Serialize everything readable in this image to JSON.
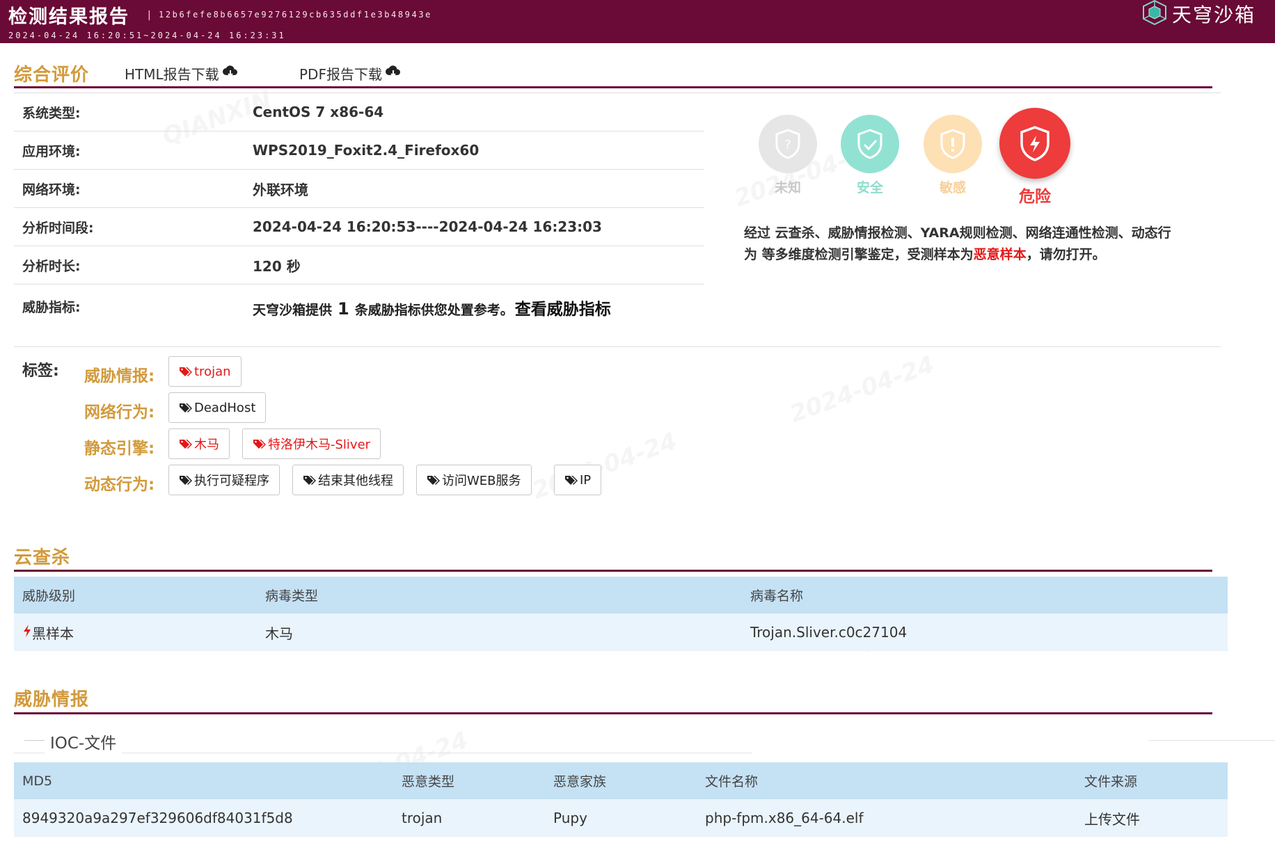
{
  "header": {
    "title": "检测结果报告",
    "separator": "|",
    "hash": "12b6fefe8b6657e9276129cb635ddf1e3b48943e",
    "period": "2024-04-24 16:20:51~2024-04-24 16:23:31",
    "brand": "天穹沙箱",
    "bg_color": "#6a0a36"
  },
  "summary": {
    "title": "综合评价",
    "html_download": "HTML报告下载",
    "pdf_download": "PDF报告下载",
    "rows": [
      {
        "label": "系统类型:",
        "value": "CentOS 7 x86-64"
      },
      {
        "label": "应用环境:",
        "value": "WPS2019_Foxit2.4_Firefox60"
      },
      {
        "label": "网络环境:",
        "value": "外联环境"
      },
      {
        "label": "分析时间段:",
        "value": "2024-04-24 16:20:53----2024-04-24 16:23:03"
      },
      {
        "label": "分析时长:",
        "value": "120 秒"
      }
    ],
    "ioc": {
      "label": "威胁指标:",
      "prefix": "天穹沙箱提供",
      "count": "1",
      "suffix": "条威胁指标供您处置参考。",
      "link": "查看威胁指标"
    }
  },
  "risk": {
    "levels": [
      {
        "label": "未知",
        "icon": "question-shield-icon",
        "color": "#d4d4d4",
        "active": false
      },
      {
        "label": "安全",
        "icon": "check-shield-icon",
        "color": "#6fd7c4",
        "active": false
      },
      {
        "label": "敏感",
        "icon": "exclamation-shield-icon",
        "color": "#fbd49a",
        "active": false
      },
      {
        "label": "危险",
        "icon": "lightning-shield-icon",
        "color": "#ee3b3b",
        "active": true
      }
    ],
    "verdict": {
      "line1": "经过 云查杀、威胁情报检测、YARA规则检测、网络连通性检测、动态行",
      "line2_prefix": "为 等多维度检测引擎鉴定，受测样本为",
      "highlight": "恶意样本",
      "line2_suffix": "，请勿打开。"
    }
  },
  "tags": {
    "label": "标签:",
    "categories": [
      {
        "name": "威胁情报:",
        "items": [
          {
            "text": "trojan",
            "color": "red"
          }
        ]
      },
      {
        "name": "网络行为:",
        "items": [
          {
            "text": "DeadHost",
            "color": "dark"
          }
        ]
      },
      {
        "name": "静态引擎:",
        "items": [
          {
            "text": "木马",
            "color": "red"
          },
          {
            "text": "特洛伊木马-Sliver",
            "color": "red"
          }
        ]
      },
      {
        "name": "动态行为:",
        "items": [
          {
            "text": "执行可疑程序",
            "color": "dark"
          },
          {
            "text": "结束其他线程",
            "color": "dark"
          },
          {
            "text": "访问WEB服务",
            "color": "dark"
          },
          {
            "text": "IP",
            "color": "dark"
          }
        ]
      }
    ]
  },
  "cloud_scan": {
    "title": "云查杀",
    "columns": [
      "威胁级别",
      "病毒类型",
      "病毒名称"
    ],
    "rows": [
      {
        "level": "黑样本",
        "type": "木马",
        "name": "Trojan.Sliver.c0c27104"
      }
    ]
  },
  "threat_intel": {
    "title": "威胁情报",
    "subtitle": "IOC-文件",
    "columns": [
      "MD5",
      "恶意类型",
      "恶意家族",
      "文件名称",
      "文件来源"
    ],
    "rows": [
      {
        "md5": "8949320a9a297ef329606df84031f5d8",
        "mal_type": "trojan",
        "family": "Pupy",
        "filename": "php-fpm.x86_64-64.elf",
        "source": "上传文件"
      }
    ]
  }
}
